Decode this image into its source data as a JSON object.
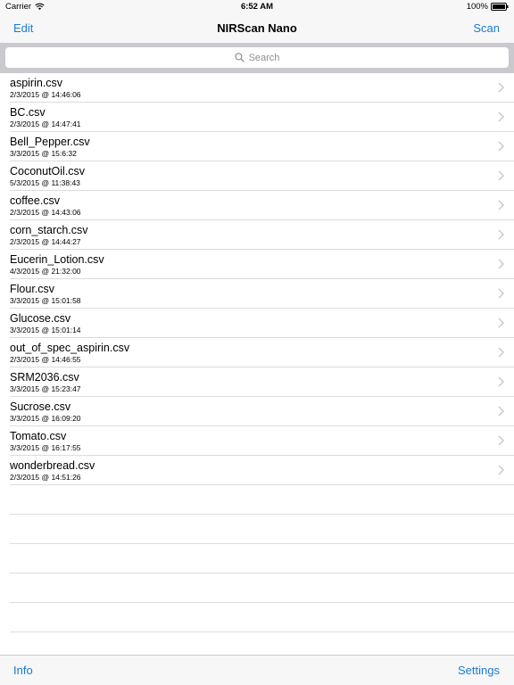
{
  "status": {
    "carrier": "Carrier",
    "time": "6:52 AM",
    "battery": "100%"
  },
  "nav": {
    "left": "Edit",
    "title": "NIRScan Nano",
    "right": "Scan"
  },
  "search": {
    "placeholder": "Search"
  },
  "files": [
    {
      "name": "aspirin.csv",
      "date": "2/3/2015 @ 14:46:06"
    },
    {
      "name": "BC.csv",
      "date": "2/3/2015 @ 14:47:41"
    },
    {
      "name": "Bell_Pepper.csv",
      "date": "3/3/2015 @ 15:6:32"
    },
    {
      "name": "CoconutOil.csv",
      "date": "5/3/2015 @ 11:38:43"
    },
    {
      "name": "coffee.csv",
      "date": "2/3/2015 @ 14:43:06"
    },
    {
      "name": "corn_starch.csv",
      "date": "2/3/2015 @ 14:44:27"
    },
    {
      "name": "Eucerin_Lotion.csv",
      "date": "4/3/2015 @ 21:32:00"
    },
    {
      "name": "Flour.csv",
      "date": "3/3/2015 @ 15:01:58"
    },
    {
      "name": "Glucose.csv",
      "date": "3/3/2015 @ 15:01:14"
    },
    {
      "name": "out_of_spec_aspirin.csv",
      "date": "2/3/2015 @ 14:46:55"
    },
    {
      "name": "SRM2036.csv",
      "date": "3/3/2015 @ 15:23:47"
    },
    {
      "name": "Sucrose.csv",
      "date": "3/3/2015 @ 16:09:20"
    },
    {
      "name": "Tomato.csv",
      "date": "3/3/2015 @ 16:17:55"
    },
    {
      "name": "wonderbread.csv",
      "date": "2/3/2015 @ 14:51:26"
    }
  ],
  "toolbar": {
    "left": "Info",
    "right": "Settings"
  },
  "colors": {
    "accent": "#1a7bd6"
  },
  "icons": {
    "wifi": "wifi-icon",
    "battery": "battery-icon",
    "search": "search-icon",
    "disclosure": "chevron-right-icon"
  }
}
